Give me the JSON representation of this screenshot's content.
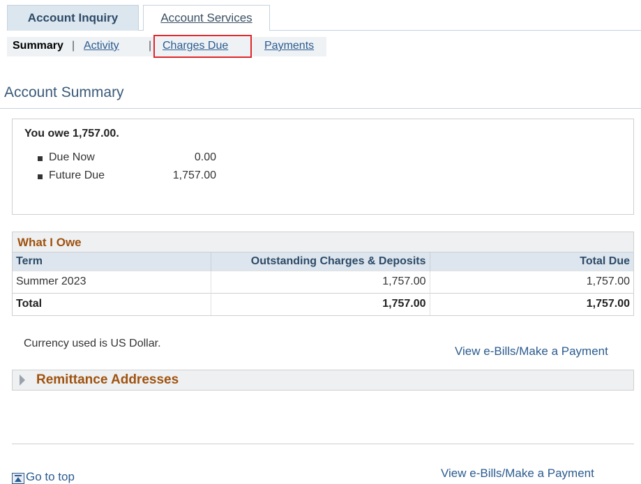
{
  "tabs": {
    "active": "Account Inquiry",
    "inactive": "Account Services"
  },
  "subnav": {
    "summary": "Summary",
    "sep1": "|",
    "activity": "Activity",
    "sep2": "|",
    "charges_due": "Charges Due",
    "payments": "Payments"
  },
  "page_title": "Account Summary",
  "owe_summary": {
    "heading": "You owe 1,757.00.",
    "items": [
      {
        "label": "Due Now",
        "amount": "0.00"
      },
      {
        "label": "Future Due",
        "amount": "1,757.00"
      }
    ]
  },
  "what_i_owe": {
    "caption": "What I Owe",
    "headers": [
      "Term",
      "Outstanding Charges & Deposits",
      "Total Due"
    ],
    "rows": [
      [
        "Summer 2023",
        "1,757.00",
        "1,757.00"
      ]
    ],
    "total": [
      "Total",
      "1,757.00",
      "1,757.00"
    ]
  },
  "currency_note": "Currency used is US Dollar.",
  "view_ebills_label": "View e-Bills/Make a Payment",
  "remittance_label": "Remittance Addresses",
  "go_to_top_label": "Go to top",
  "colors": {
    "accent_orange": "#a0520e",
    "link_blue": "#2b5b8f",
    "highlight_red": "#e0252b"
  }
}
